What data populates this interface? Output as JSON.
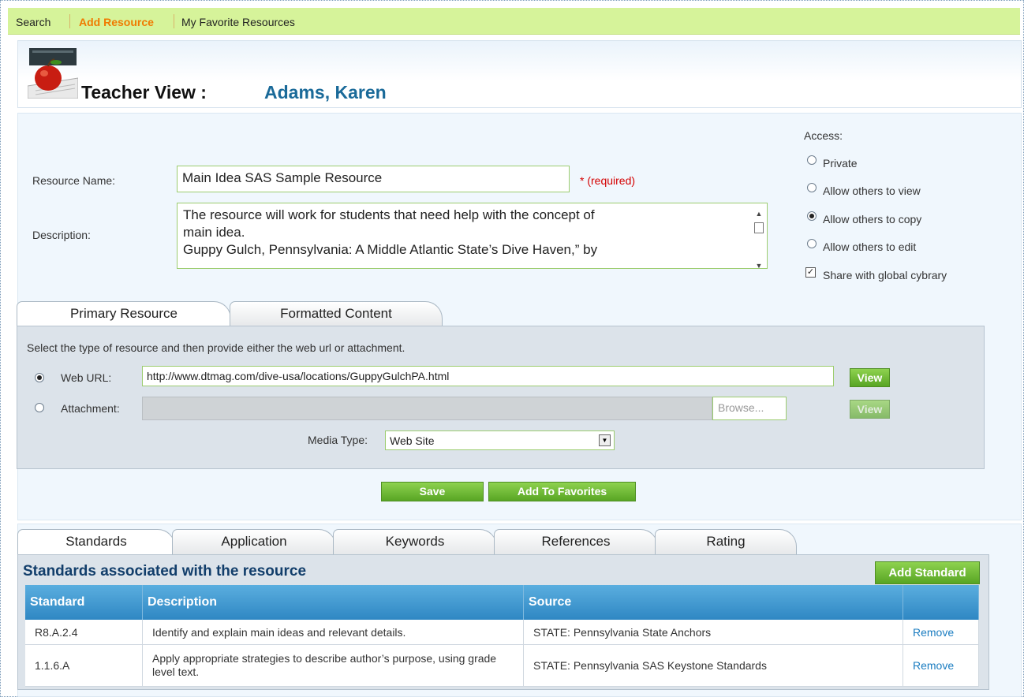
{
  "nav": {
    "items": [
      "Search",
      "Add Resource",
      "My Favorite Resources"
    ],
    "active_color": "#f07a00"
  },
  "header": {
    "title": "Teacher View :",
    "teacher_name": "Adams, Karen"
  },
  "form": {
    "resource_name_label": "Resource Name:",
    "resource_name_value": "Main Idea SAS Sample Resource",
    "required_text": "* (required)",
    "description_label": "Description:",
    "description_lines": [
      "The resource will work for students that need help with the concept of",
      "main idea.",
      "Guppy Gulch, Pennsylvania: A Middle Atlantic State’s Dive Haven,” by"
    ]
  },
  "access": {
    "title": "Access:",
    "options": [
      "Private",
      "Allow others to view",
      "Allow others to copy",
      "Allow others to edit"
    ],
    "selected": "Allow others to copy",
    "share_label": "Share with global cybrary",
    "share_checked": true
  },
  "resource_tabs": [
    "Primary Resource",
    "Formatted Content"
  ],
  "primary": {
    "instructions": "Select the type of resource and then provide either the web url or attachment.",
    "web_url_label": "Web URL:",
    "web_url_value": "http://www.dtmag.com/dive-usa/locations/GuppyGulchPA.html",
    "attachment_label": "Attachment:",
    "browse_label": "Browse...",
    "view_label": "View",
    "media_type_label": "Media Type:",
    "media_type_value": "Web Site",
    "selected_type": "Web URL"
  },
  "actions": {
    "save": "Save",
    "add_favorites": "Add To Favorites"
  },
  "bottom_tabs": [
    "Standards",
    "Application",
    "Keywords",
    "References",
    "Rating"
  ],
  "standards": {
    "heading": "Standards associated with the resource",
    "add_button": "Add Standard",
    "columns": [
      "Standard",
      "Description",
      "Source",
      ""
    ],
    "rows": [
      {
        "standard": "R8.A.2.4",
        "description": "Identify and explain main ideas and relevant details.",
        "source": "STATE: Pennsylvania State Anchors",
        "action": "Remove"
      },
      {
        "standard": "1.1.6.A",
        "description": "Apply appropriate strategies to describe author’s purpose, using grade level text.",
        "source": "STATE: Pennsylvania SAS Keystone Standards",
        "action": "Remove"
      }
    ]
  },
  "colors": {
    "nav_bg": "#d6f39a",
    "name_color": "#1a6a99",
    "table_header": "#3a93cc",
    "button_green": "#6cbf35",
    "link": "#1a7cc0"
  }
}
